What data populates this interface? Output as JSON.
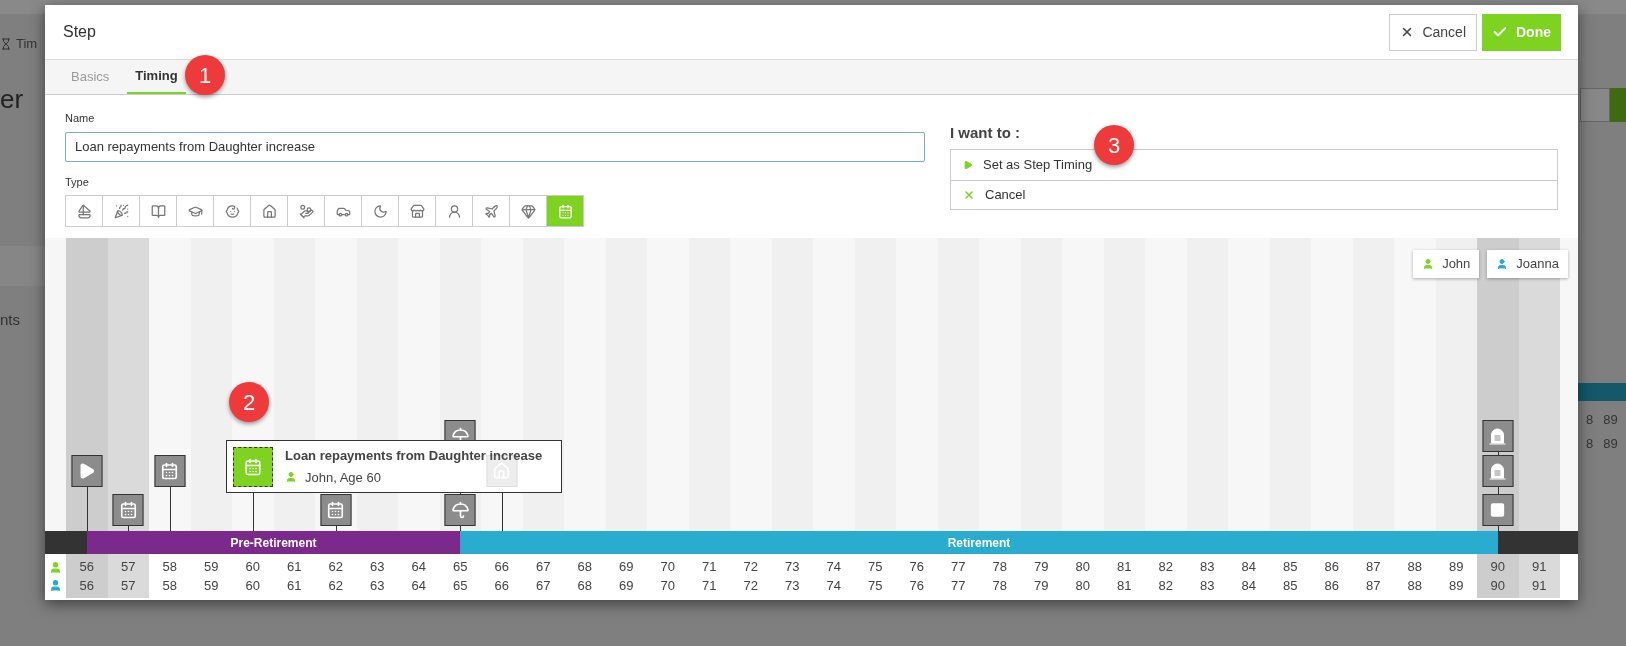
{
  "background_page": {
    "tab_fragment": "Tim",
    "heading_fragment": "er",
    "list_fragment": "nts",
    "table_rows": [
      [
        "8",
        "89"
      ],
      [
        "8",
        "89"
      ]
    ]
  },
  "dialog": {
    "title": "Step",
    "buttons": [
      {
        "kind": "cancel",
        "label": "Cancel"
      },
      {
        "kind": "done",
        "label": "Done"
      }
    ],
    "tabs": [
      {
        "label": "Basics",
        "selected": false
      },
      {
        "label": "Timing",
        "selected": true
      }
    ],
    "name_field": {
      "label": "Name",
      "value": "Loan repayments from Daughter increase"
    },
    "type_label": "Type",
    "type_options": [
      {
        "kind": "boat",
        "selected": false
      },
      {
        "kind": "party",
        "selected": false
      },
      {
        "kind": "book",
        "selected": false
      },
      {
        "kind": "graduation",
        "selected": false
      },
      {
        "kind": "baby",
        "selected": false
      },
      {
        "kind": "house",
        "selected": false
      },
      {
        "kind": "money",
        "selected": false
      },
      {
        "kind": "car",
        "selected": false
      },
      {
        "kind": "moon",
        "selected": false
      },
      {
        "kind": "store",
        "selected": false
      },
      {
        "kind": "person",
        "selected": false
      },
      {
        "kind": "plane",
        "selected": false
      },
      {
        "kind": "gem",
        "selected": false
      },
      {
        "kind": "calendar",
        "selected": true
      }
    ],
    "actions": {
      "title": "I want to :",
      "items": [
        {
          "kind": "play",
          "label": "Set as Step Timing"
        },
        {
          "kind": "cancel",
          "label": "Cancel"
        }
      ]
    },
    "people": [
      {
        "name": "John",
        "color": "#7ed321"
      },
      {
        "name": "Joanna",
        "color": "#2aabd0"
      }
    ],
    "phases": [
      {
        "label": "Pre-Retirement",
        "color": "#7b2a8c"
      },
      {
        "label": "Retirement",
        "color": "#2aabd0"
      }
    ],
    "tooltip": {
      "title": "Loan repayments from Daughter increase",
      "subtitle": "John, Age 60"
    },
    "columns": [
      {
        "kind": "dark",
        "john_age": "56",
        "joanna_age": "56",
        "middle_marker": {
          "kind": "start",
          "selected": false,
          "faded": false
        }
      },
      {
        "kind": "medium",
        "john_age": "57",
        "joanna_age": "57",
        "bottom_marker": {
          "kind": "calendar",
          "selected": false,
          "faded": false
        }
      },
      {
        "kind": "plain",
        "john_age": "58",
        "joanna_age": "58",
        "middle_marker": {
          "kind": "calendar",
          "selected": false,
          "faded": false
        }
      },
      {
        "kind": "plain",
        "john_age": "59",
        "joanna_age": "59"
      },
      {
        "kind": "plain",
        "john_age": "60",
        "joanna_age": "60",
        "middle_marker": {
          "kind": "calendar",
          "selected": true,
          "faded": false
        }
      },
      {
        "kind": "plain",
        "john_age": "61",
        "joanna_age": "61"
      },
      {
        "kind": "plain",
        "john_age": "62",
        "joanna_age": "62",
        "bottom_marker": {
          "kind": "calendar",
          "selected": false,
          "faded": false
        }
      },
      {
        "kind": "plain",
        "john_age": "63",
        "joanna_age": "63"
      },
      {
        "kind": "plain",
        "john_age": "64",
        "joanna_age": "64"
      },
      {
        "kind": "plain",
        "john_age": "65",
        "joanna_age": "65",
        "top_marker": {
          "kind": "umbrella",
          "selected": false,
          "faded": false
        },
        "bottom_marker": {
          "kind": "umbrella",
          "selected": false,
          "faded": false
        }
      },
      {
        "kind": "plain",
        "john_age": "66",
        "joanna_age": "66",
        "middle_marker": {
          "kind": "house",
          "selected": false,
          "faded": true
        }
      },
      {
        "kind": "plain",
        "john_age": "67",
        "joanna_age": "67"
      },
      {
        "kind": "plain",
        "john_age": "68",
        "joanna_age": "68"
      },
      {
        "kind": "plain",
        "john_age": "69",
        "joanna_age": "69"
      },
      {
        "kind": "plain",
        "john_age": "70",
        "joanna_age": "70"
      },
      {
        "kind": "plain",
        "john_age": "71",
        "joanna_age": "71"
      },
      {
        "kind": "plain",
        "john_age": "72",
        "joanna_age": "72"
      },
      {
        "kind": "plain",
        "john_age": "73",
        "joanna_age": "73"
      },
      {
        "kind": "plain",
        "john_age": "74",
        "joanna_age": "74"
      },
      {
        "kind": "plain",
        "john_age": "75",
        "joanna_age": "75"
      },
      {
        "kind": "plain",
        "john_age": "76",
        "joanna_age": "76"
      },
      {
        "kind": "plain",
        "john_age": "77",
        "joanna_age": "77"
      },
      {
        "kind": "plain",
        "john_age": "78",
        "joanna_age": "78"
      },
      {
        "kind": "plain",
        "john_age": "79",
        "joanna_age": "79"
      },
      {
        "kind": "plain",
        "john_age": "80",
        "joanna_age": "80"
      },
      {
        "kind": "plain",
        "john_age": "81",
        "joanna_age": "81"
      },
      {
        "kind": "plain",
        "john_age": "82",
        "joanna_age": "82"
      },
      {
        "kind": "plain",
        "john_age": "83",
        "joanna_age": "83"
      },
      {
        "kind": "plain",
        "john_age": "84",
        "joanna_age": "84"
      },
      {
        "kind": "plain",
        "john_age": "85",
        "joanna_age": "85"
      },
      {
        "kind": "plain",
        "john_age": "86",
        "joanna_age": "86"
      },
      {
        "kind": "plain",
        "john_age": "87",
        "joanna_age": "87"
      },
      {
        "kind": "plain",
        "john_age": "88",
        "joanna_age": "88"
      },
      {
        "kind": "plain",
        "john_age": "89",
        "joanna_age": "89"
      },
      {
        "kind": "dark",
        "john_age": "90",
        "joanna_age": "90",
        "top_marker": {
          "kind": "tombstone",
          "selected": false,
          "faded": false
        },
        "middle_marker": {
          "kind": "tombstone",
          "selected": false,
          "faded": false
        },
        "bottom_marker": {
          "kind": "end",
          "selected": false,
          "faded": false
        }
      },
      {
        "kind": "medium",
        "john_age": "91",
        "joanna_age": "91"
      }
    ]
  },
  "callouts": [
    {
      "label": "1"
    },
    {
      "label": "2"
    },
    {
      "label": "3"
    }
  ]
}
